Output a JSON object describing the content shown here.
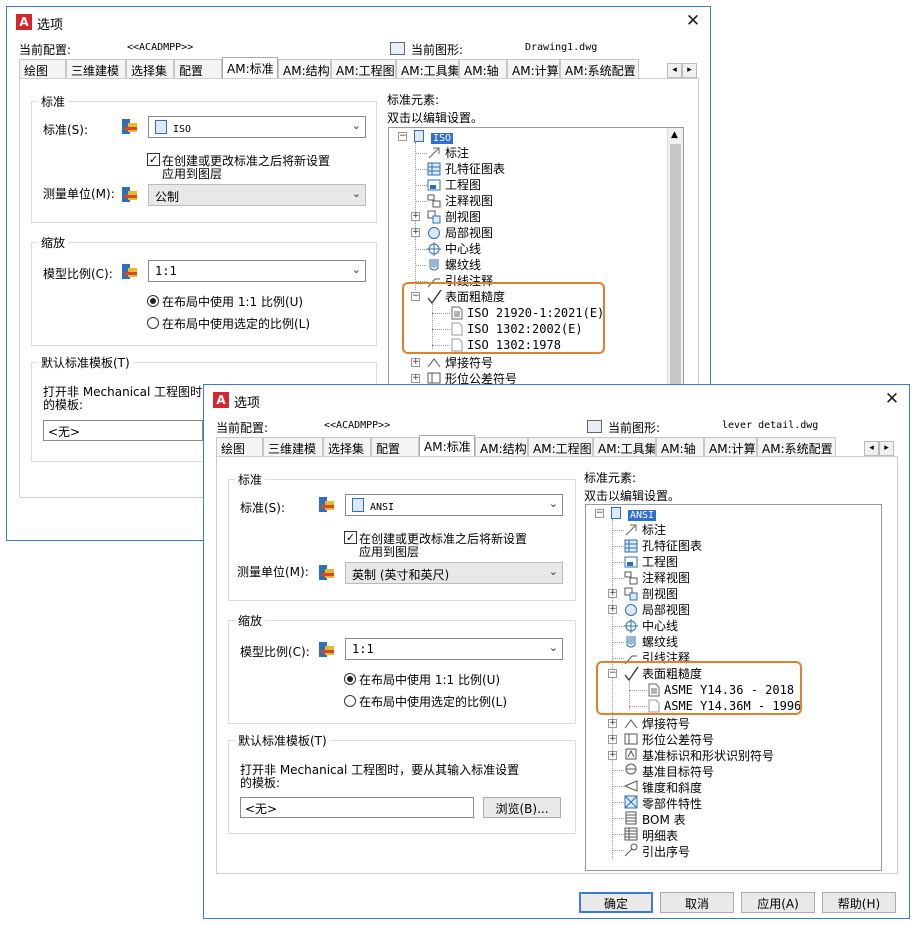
{
  "back": {
    "title": "选项",
    "current_profile_label": "当前配置:",
    "current_profile": "<<ACADMPP>>",
    "current_drawing_label": "当前图形:",
    "current_drawing": "Drawing1.dwg",
    "tabs": [
      "绘图",
      "三维建模",
      "选择集",
      "配置",
      "AM:标准",
      "AM:结构",
      "AM:工程图",
      "AM:工具集",
      "AM:轴",
      "AM:计算",
      "AM:系统配置"
    ],
    "standard_group": "标准",
    "standard_label": "标准(S):",
    "standard_value": "ISO",
    "checkbox_label_1": "在创建或更改标准之后将新设置",
    "checkbox_label_2": "应用到图层",
    "unit_label": "测量单位(M):",
    "unit_value": "公制",
    "scale_group": "缩放",
    "scale_label": "模型比例(C):",
    "scale_value": "1:1",
    "radio_1": "在布局中使用 1:1 比例(U)",
    "radio_2": "在布局中使用选定的比例(L)",
    "template_group": "默认标准模板(T)",
    "template_text_1": "打开非 Mechanical 工程图时，要从其输入标准设置",
    "template_text_2": "的模板:",
    "template_value": "<无>",
    "elements_label": "标准元素:",
    "elements_hint": "双击以编辑设置。",
    "tree": {
      "root": "ISO",
      "items": [
        "标注",
        "孔特征图表",
        "工程图",
        "注释视图",
        "剖视图",
        "局部视图",
        "中心线",
        "螺纹线",
        "引线注释"
      ],
      "roughness": "表面粗糙度",
      "roughness_children": [
        "ISO 21920-1:2021(E)",
        "ISO 1302:2002(E)",
        "ISO 1302:1978"
      ],
      "after": [
        "焊接符号",
        "形位公差符号"
      ]
    }
  },
  "front": {
    "title": "选项",
    "current_profile_label": "当前配置:",
    "current_profile": "<<ACADMPP>>",
    "current_drawing_label": "当前图形:",
    "current_drawing": "lever detail.dwg",
    "tabs": [
      "绘图",
      "三维建模",
      "选择集",
      "配置",
      "AM:标准",
      "AM:结构",
      "AM:工程图",
      "AM:工具集",
      "AM:轴",
      "AM:计算",
      "AM:系统配置"
    ],
    "standard_group": "标准",
    "standard_label": "标准(S):",
    "standard_value": "ANSI",
    "checkbox_label_1": "在创建或更改标准之后将新设置",
    "checkbox_label_2": "应用到图层",
    "unit_label": "测量单位(M):",
    "unit_value": "英制 (英寸和英尺)",
    "scale_group": "缩放",
    "scale_label": "模型比例(C):",
    "scale_value": "1:1",
    "radio_1": "在布局中使用 1:1 比例(U)",
    "radio_2": "在布局中使用选定的比例(L)",
    "template_group": "默认标准模板(T)",
    "template_text_1": "打开非 Mechanical 工程图时，要从其输入标准设置",
    "template_text_2": "的模板:",
    "template_value": "<无>",
    "browse": "浏览(B)...",
    "elements_label": "标准元素:",
    "elements_hint": "双击以编辑设置。",
    "tree": {
      "root": "ANSI",
      "items": [
        "标注",
        "孔特征图表",
        "工程图",
        "注释视图",
        "剖视图",
        "局部视图",
        "中心线",
        "螺纹线",
        "引线注释"
      ],
      "roughness": "表面粗糙度",
      "roughness_children": [
        "ASME Y14.36 - 2018",
        "ASME Y14.36M - 1996"
      ],
      "after": [
        "焊接符号",
        "形位公差符号",
        "基准标识和形状识别符号",
        "基准目标符号",
        "锥度和斜度",
        "零部件特性",
        "BOM 表",
        "明细表",
        "引出序号"
      ]
    },
    "buttons": {
      "ok": "确定",
      "cancel": "取消",
      "apply": "应用(A)",
      "help": "帮助(H)"
    }
  },
  "colors": {
    "highlight": "#2f6fd0",
    "callout": "#e0812d",
    "dialog_border": "#3a7bd5"
  }
}
